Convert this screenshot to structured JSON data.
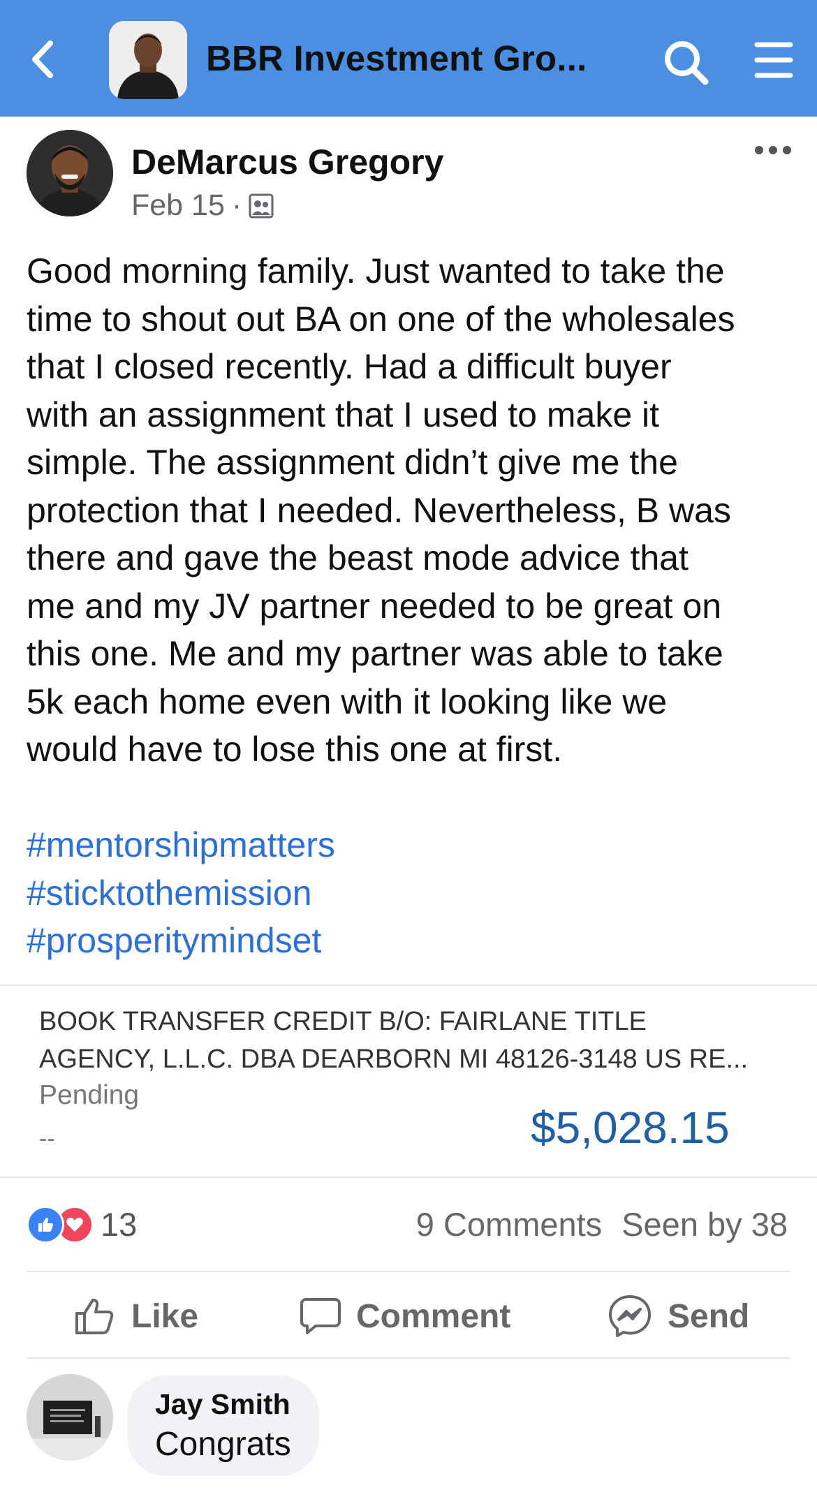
{
  "header": {
    "back_icon": "chevron-left-icon",
    "group_title": "BBR Investment Gro...",
    "search_icon": "search-icon",
    "menu_icon": "hamburger-menu-icon",
    "background_color": "#4a8fe1"
  },
  "post": {
    "author": "DeMarcus Gregory",
    "date": "Feb 15",
    "separator": "·",
    "audience_icon": "group-audience-icon",
    "more_icon": "more-options-icon",
    "body_lines": [
      "Good morning family. Just wanted to take the",
      "time to shout out BA on one of the wholesales",
      "that I closed recently. Had a difficult buyer",
      "with an assignment that I used to make it",
      "simple. The assignment didn’t give me the",
      "protection that I needed. Nevertheless, B was",
      "there and gave the beast mode advice that",
      "me and my JV partner needed to be great on",
      "this one. Me and my partner was able to take",
      "5k each home even with it looking like we",
      "would have to lose this one at first."
    ],
    "hashtags": [
      "#mentorshipmatters",
      "#sticktothemission",
      "#prosperitymindset"
    ],
    "hashtag_color": "#2a6fdb"
  },
  "attachment": {
    "description_line1": "BOOK TRANSFER CREDIT B/O: FAIRLANE TITLE",
    "description_line2": "AGENCY, L.L.C. DBA DEARBORN MI 48126-3148 US RE...",
    "status": "Pending",
    "dash": "--",
    "amount": "$5,028.15",
    "amount_color": "#1f5fa8"
  },
  "engagement": {
    "reaction_count": "13",
    "comments": "9 Comments",
    "seen_by": "Seen by 38"
  },
  "actions": {
    "like": "Like",
    "comment": "Comment",
    "send": "Send"
  },
  "comment": {
    "author": "Jay Smith",
    "text": "Congrats"
  }
}
